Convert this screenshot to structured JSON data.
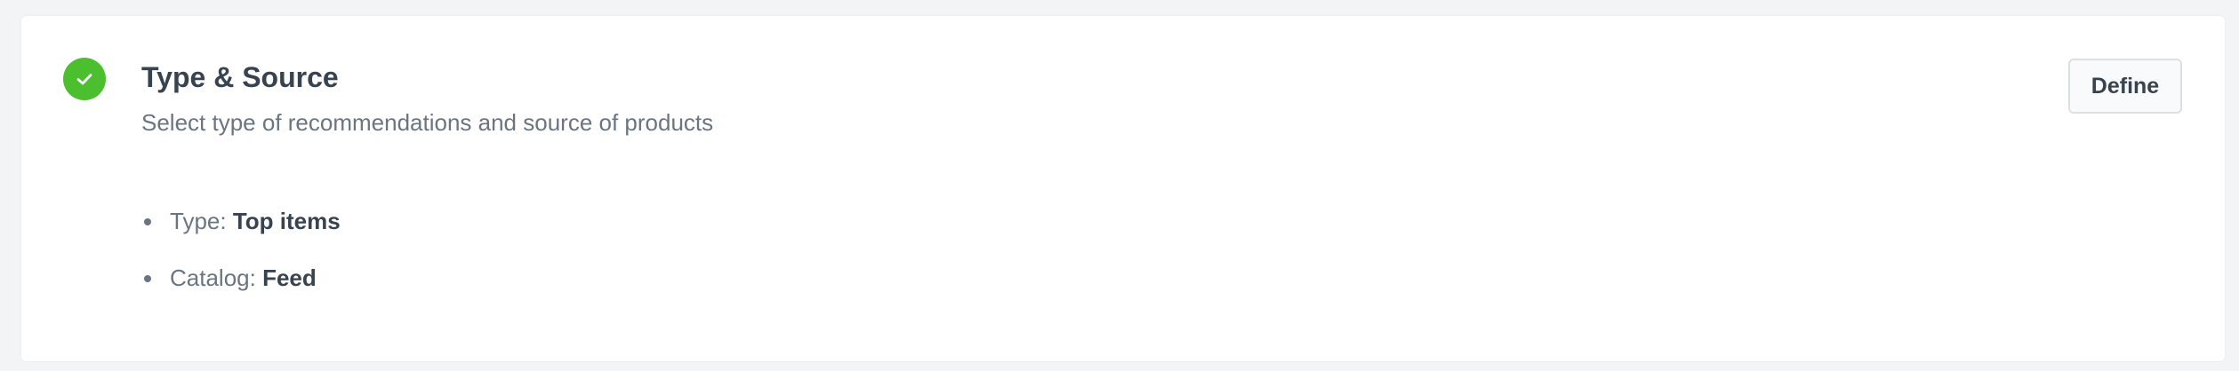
{
  "section": {
    "title": "Type & Source",
    "subtitle": "Select type of recommendations and source of products",
    "status": "completed",
    "status_color": "#4bbf2e",
    "status_icon": "check-icon",
    "define_label": "Define",
    "details": [
      {
        "label": "Type:",
        "value": "Top items"
      },
      {
        "label": "Catalog:",
        "value": "Feed"
      }
    ]
  }
}
